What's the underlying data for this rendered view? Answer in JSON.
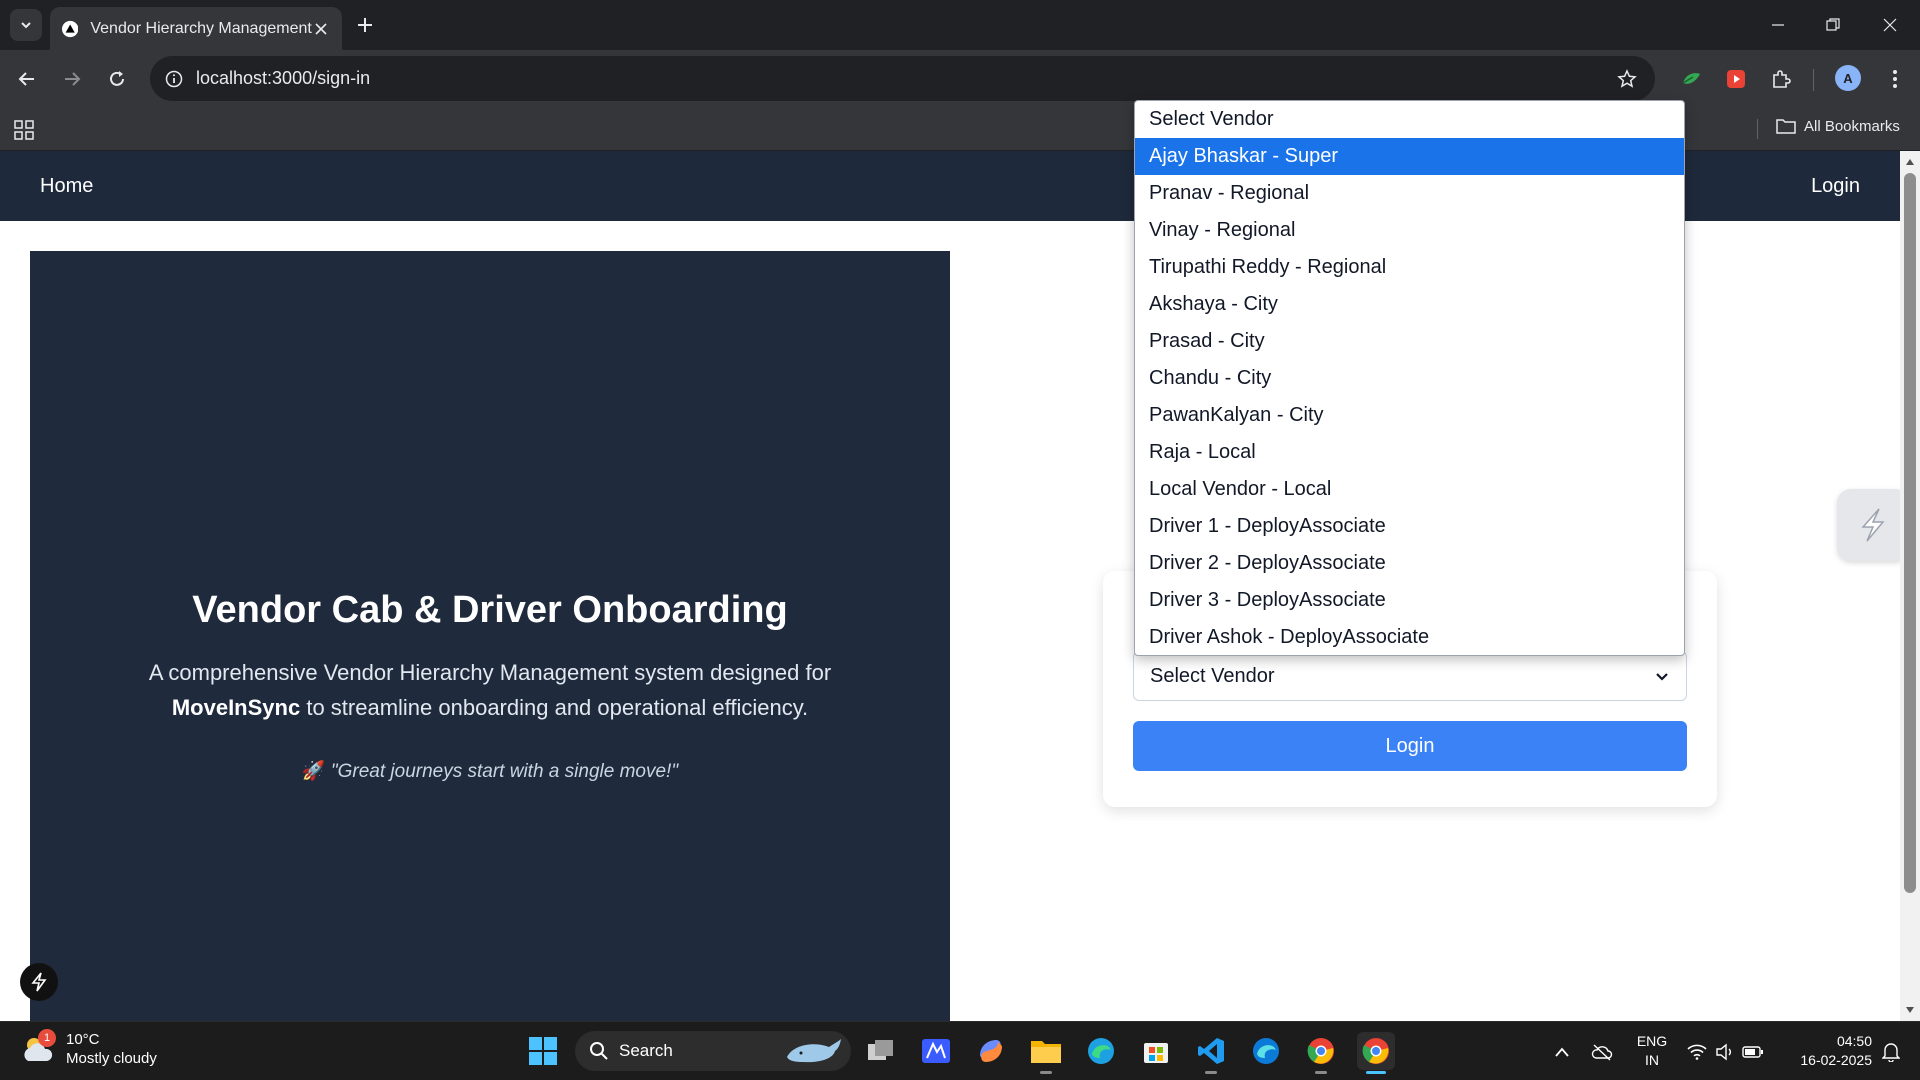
{
  "browser": {
    "tab_title": "Vendor Hierarchy Management",
    "url": "localhost:3000/sign-in",
    "profile_initial": "A",
    "all_bookmarks_label": "All Bookmarks"
  },
  "navbar": {
    "home_label": "Home",
    "login_label": "Login"
  },
  "hero": {
    "title": "Vendor Cab & Driver Onboarding",
    "description_prefix": "A comprehensive Vendor Hierarchy Management system designed for",
    "brand": "MoveInSync",
    "description_suffix": "to streamline onboarding and operational efficiency.",
    "quote_emoji": "🚀",
    "quote": "\"Great journeys start with a single move!\""
  },
  "login_card": {
    "select_value": "Select Vendor",
    "login_button": "Login"
  },
  "dropdown": {
    "options": [
      "Select Vendor",
      "Ajay Bhaskar - Super",
      "Pranav - Regional",
      "Vinay - Regional",
      "Tirupathi Reddy - Regional",
      "Akshaya - City",
      "Prasad - City",
      "Chandu - City",
      "PawanKalyan - City",
      "Raja - Local",
      "Local Vendor - Local",
      "Driver 1 - DeployAssociate",
      "Driver 2 - DeployAssociate",
      "Driver 3 - DeployAssociate",
      "Driver Ashok - DeployAssociate"
    ],
    "highlighted_option": "Ajay Bhaskar - Super"
  },
  "taskbar": {
    "weather_temp": "10°C",
    "weather_desc": "Mostly cloudy",
    "weather_badge": "1",
    "search_label": "Search",
    "lang_line1": "ENG",
    "lang_line2": "IN",
    "time": "04:50",
    "date": "16-02-2025"
  },
  "colors": {
    "navbar_bg": "#1e293b",
    "hero_bg": "#1f2a3c",
    "primary_button": "#3b82f6",
    "dropdown_highlight": "#1a73e8"
  }
}
